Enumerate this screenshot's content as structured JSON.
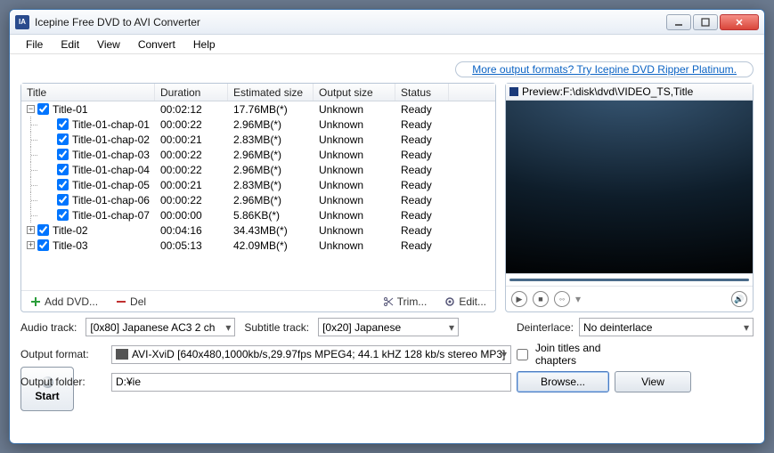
{
  "title": "Icepine Free DVD to AVI Converter",
  "menu": {
    "file": "File",
    "edit": "Edit",
    "view": "View",
    "convert": "Convert",
    "help": "Help"
  },
  "promo": "More output formats? Try Icepine DVD Ripper Platinum.",
  "columns": {
    "title": "Title",
    "duration": "Duration",
    "est": "Estimated size",
    "out": "Output size",
    "status": "Status"
  },
  "rows": [
    {
      "title": "Title-01",
      "dur": "00:02:12",
      "est": "17.76MB(*)",
      "out": "Unknown",
      "st": "Ready",
      "level": 0,
      "exp": "minus"
    },
    {
      "title": "Title-01-chap-01",
      "dur": "00:00:22",
      "est": "2.96MB(*)",
      "out": "Unknown",
      "st": "Ready",
      "level": 1
    },
    {
      "title": "Title-01-chap-02",
      "dur": "00:00:21",
      "est": "2.83MB(*)",
      "out": "Unknown",
      "st": "Ready",
      "level": 1
    },
    {
      "title": "Title-01-chap-03",
      "dur": "00:00:22",
      "est": "2.96MB(*)",
      "out": "Unknown",
      "st": "Ready",
      "level": 1
    },
    {
      "title": "Title-01-chap-04",
      "dur": "00:00:22",
      "est": "2.96MB(*)",
      "out": "Unknown",
      "st": "Ready",
      "level": 1
    },
    {
      "title": "Title-01-chap-05",
      "dur": "00:00:21",
      "est": "2.83MB(*)",
      "out": "Unknown",
      "st": "Ready",
      "level": 1
    },
    {
      "title": "Title-01-chap-06",
      "dur": "00:00:22",
      "est": "2.96MB(*)",
      "out": "Unknown",
      "st": "Ready",
      "level": 1
    },
    {
      "title": "Title-01-chap-07",
      "dur": "00:00:00",
      "est": "5.86KB(*)",
      "out": "Unknown",
      "st": "Ready",
      "level": 1
    },
    {
      "title": "Title-02",
      "dur": "00:04:16",
      "est": "34.43MB(*)",
      "out": "Unknown",
      "st": "Ready",
      "level": 0,
      "exp": "plus"
    },
    {
      "title": "Title-03",
      "dur": "00:05:13",
      "est": "42.09MB(*)",
      "out": "Unknown",
      "st": "Ready",
      "level": 0,
      "exp": "plus"
    }
  ],
  "toolbar": {
    "add": "Add DVD...",
    "del": "Del",
    "trim": "Trim...",
    "edit": "Edit..."
  },
  "preview_label": "Preview:F:\\disk\\dvd\\VIDEO_TS,Title",
  "labels": {
    "audio": "Audio track:",
    "subtitle": "Subtitle track:",
    "deinterlace": "Deinterlace:",
    "fmt": "Output format:",
    "folder": "Output folder:"
  },
  "audio_track": "[0x80] Japanese AC3 2 ch",
  "subtitle_track": "[0x20] Japanese",
  "deinterlace": "No deinterlace",
  "join": "Join titles and chapters",
  "format": "AVI-XviD [640x480,1000kb/s,29.97fps MPEG4;  44.1 kHZ 128 kb/s stereo MP3]",
  "folder": "D:¥ie",
  "browse": "Browse...",
  "view": "View",
  "start": "Start"
}
